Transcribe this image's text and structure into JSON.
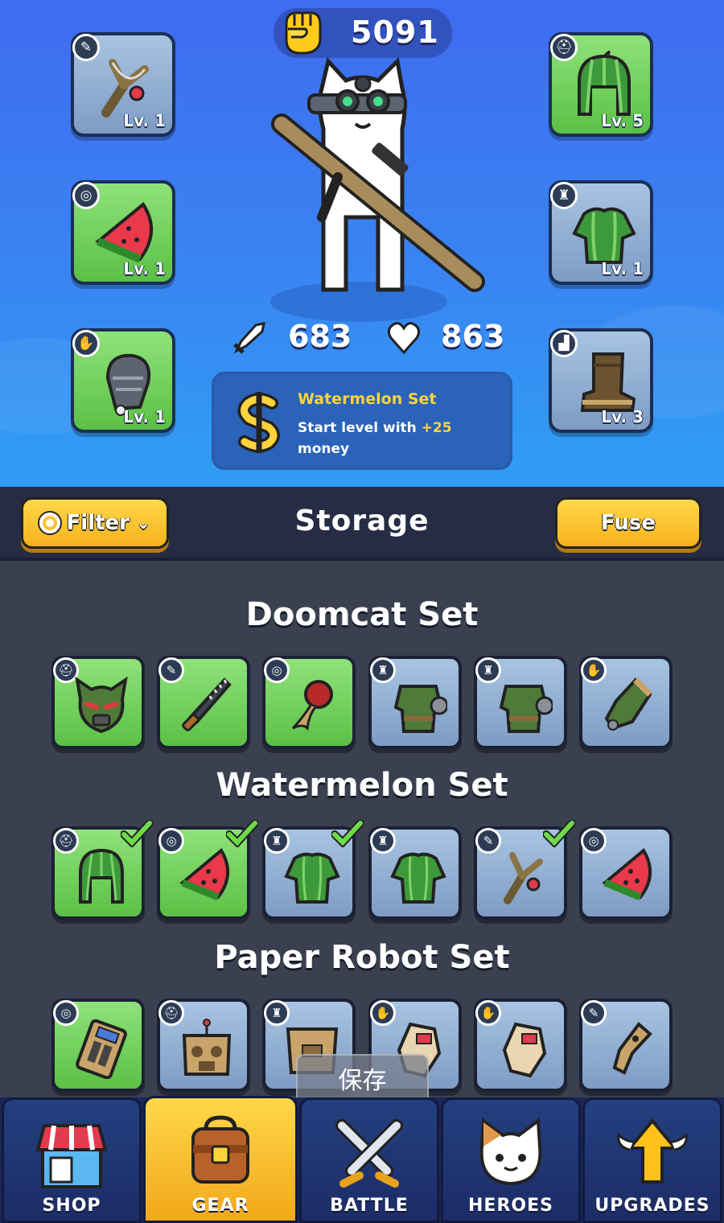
{
  "hero": {
    "power_value": "5091",
    "attack_value": "683",
    "health_value": "863",
    "equipped": [
      {
        "slot": "weapon",
        "icon": "slingshot-icon",
        "level": "Lv. 1"
      },
      {
        "slot": "ring",
        "icon": "watermelon-slice-icon",
        "level": "Lv. 1"
      },
      {
        "slot": "gloves",
        "icon": "gauntlet-icon",
        "level": "Lv. 1"
      },
      {
        "slot": "helmet",
        "icon": "watermelon-helmet-icon",
        "level": "Lv. 5"
      },
      {
        "slot": "armor",
        "icon": "watermelon-armor-icon",
        "level": "Lv. 1"
      },
      {
        "slot": "boots",
        "icon": "boot-icon",
        "level": "Lv. 3"
      }
    ],
    "set_bonus": {
      "title": "Watermelon Set",
      "text_before": "Start level with ",
      "text_value": "+25",
      "text_after": " money"
    }
  },
  "storage": {
    "filter_label": "Filter",
    "title": "Storage",
    "fuse_label": "Fuse",
    "sets": [
      {
        "title": "Doomcat Set",
        "items": [
          {
            "icon": "doom-helmet-icon",
            "slot_icon": "helmet-slot-icon",
            "rarity": "green",
            "equipped": false
          },
          {
            "icon": "chainsaw-sword-icon",
            "slot_icon": "weapon-slot-icon",
            "rarity": "green",
            "equipped": false
          },
          {
            "icon": "wax-seal-amulet-icon",
            "slot_icon": "ring-slot-icon",
            "rarity": "green",
            "equipped": false
          },
          {
            "icon": "power-armor-icon",
            "slot_icon": "armor-slot-icon",
            "rarity": "blue",
            "equipped": false
          },
          {
            "icon": "power-armor-icon",
            "slot_icon": "armor-slot-icon",
            "rarity": "blue",
            "equipped": false
          },
          {
            "icon": "power-gauntlet-icon",
            "slot_icon": "gloves-slot-icon",
            "rarity": "blue",
            "equipped": false
          }
        ]
      },
      {
        "title": "Watermelon Set",
        "items": [
          {
            "icon": "watermelon-helmet-icon",
            "slot_icon": "helmet-slot-icon",
            "rarity": "green",
            "equipped": true
          },
          {
            "icon": "watermelon-slice-icon",
            "slot_icon": "ring-slot-icon",
            "rarity": "green",
            "equipped": true
          },
          {
            "icon": "watermelon-armor-icon",
            "slot_icon": "armor-slot-icon",
            "rarity": "blue",
            "equipped": true
          },
          {
            "icon": "watermelon-armor-icon",
            "slot_icon": "armor-slot-icon",
            "rarity": "blue",
            "equipped": false
          },
          {
            "icon": "slingshot-icon",
            "slot_icon": "weapon-slot-icon",
            "rarity": "blue",
            "equipped": true
          },
          {
            "icon": "watermelon-slice-icon",
            "slot_icon": "ring-slot-icon",
            "rarity": "blue",
            "equipped": false
          }
        ]
      },
      {
        "title": "Paper Robot Set",
        "items": [
          {
            "icon": "calculator-icon",
            "slot_icon": "ring-slot-icon",
            "rarity": "green",
            "equipped": false
          },
          {
            "icon": "cardboard-robot-head-icon",
            "slot_icon": "helmet-slot-icon",
            "rarity": "blue",
            "equipped": false
          },
          {
            "icon": "cardboard-box-armor-icon",
            "slot_icon": "armor-slot-icon",
            "rarity": "blue",
            "equipped": false
          },
          {
            "icon": "paper-glove-icon",
            "slot_icon": "gloves-slot-icon",
            "rarity": "blue",
            "equipped": false
          },
          {
            "icon": "paper-glove-icon",
            "slot_icon": "gloves-slot-icon",
            "rarity": "blue",
            "equipped": false
          },
          {
            "icon": "cardboard-gun-icon",
            "slot_icon": "weapon-slot-icon",
            "rarity": "blue",
            "equipped": false
          }
        ]
      }
    ]
  },
  "save_popup": "保存",
  "nav": {
    "active": "GEAR",
    "tabs": [
      {
        "label": "SHOP",
        "icon": "shop-icon"
      },
      {
        "label": "GEAR",
        "icon": "backpack-icon"
      },
      {
        "label": "BATTLE",
        "icon": "crossed-swords-icon"
      },
      {
        "label": "HEROES",
        "icon": "cat-face-icon"
      },
      {
        "label": "UPGRADES",
        "icon": "winged-arrow-icon"
      }
    ]
  },
  "colors": {
    "rarity_green": "#6fce58",
    "rarity_blue": "#8eaad0",
    "accent_yellow": "#ffd43a",
    "storage_bg": "#3a4050",
    "nav_bg": "#1b2758"
  }
}
